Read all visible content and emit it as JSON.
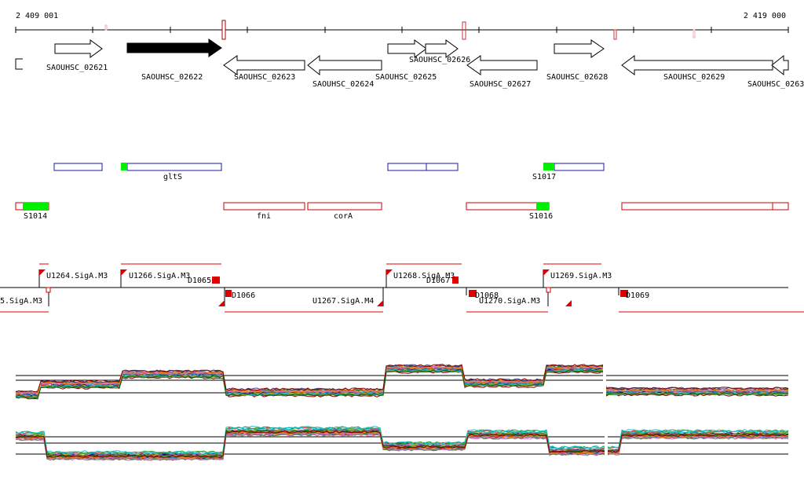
{
  "coords": {
    "start": "2 409 001",
    "end": "2 419 000"
  },
  "genes": [
    {
      "label": "SAOUHSC_02621",
      "strand": "+"
    },
    {
      "label": "SAOUHSC_02622",
      "strand": "+",
      "highlighted": true
    },
    {
      "label": "SAOUHSC_02623",
      "strand": "-"
    },
    {
      "label": "SAOUHSC_02624",
      "strand": "-"
    },
    {
      "label": "SAOUHSC_02625",
      "strand": "+"
    },
    {
      "label": "SAOUHSC_02626",
      "strand": "+"
    },
    {
      "label": "SAOUHSC_02627",
      "strand": "-"
    },
    {
      "label": "SAOUHSC_02628",
      "strand": "+"
    },
    {
      "label": "SAOUHSC_02629",
      "strand": "-"
    },
    {
      "label": "SAOUHSC_0263",
      "strand": "-"
    }
  ],
  "features_forward": [
    {
      "label": "gltS"
    },
    {
      "label": "S1017"
    }
  ],
  "features_reverse": [
    {
      "label": "S1014"
    },
    {
      "label": "fni"
    },
    {
      "label": "corA"
    },
    {
      "label": "S1016"
    }
  ],
  "segments_forward": [
    {
      "label": "U1264.SigA.M3"
    },
    {
      "label": "U1266.SigA.M3"
    },
    {
      "label": "D1065"
    },
    {
      "label": "U1268.SigA.M3"
    },
    {
      "label": "D1067"
    },
    {
      "label": "U1269.SigA.M3"
    }
  ],
  "segments_reverse": [
    {
      "label": "5.SigA.M3"
    },
    {
      "label": "D1066"
    },
    {
      "label": "U1267.SigA.M4"
    },
    {
      "label": "D1068"
    },
    {
      "label": "U1270.SigA.M3"
    },
    {
      "label": "D1069"
    }
  ],
  "colors": {
    "gene_outline": "#000000",
    "gene_highlight": "#000000",
    "forward_feature": "#1a1aa6",
    "reverse_feature": "#cc0000",
    "feature_fill": "#00ee00",
    "segment": "#dd0000"
  }
}
